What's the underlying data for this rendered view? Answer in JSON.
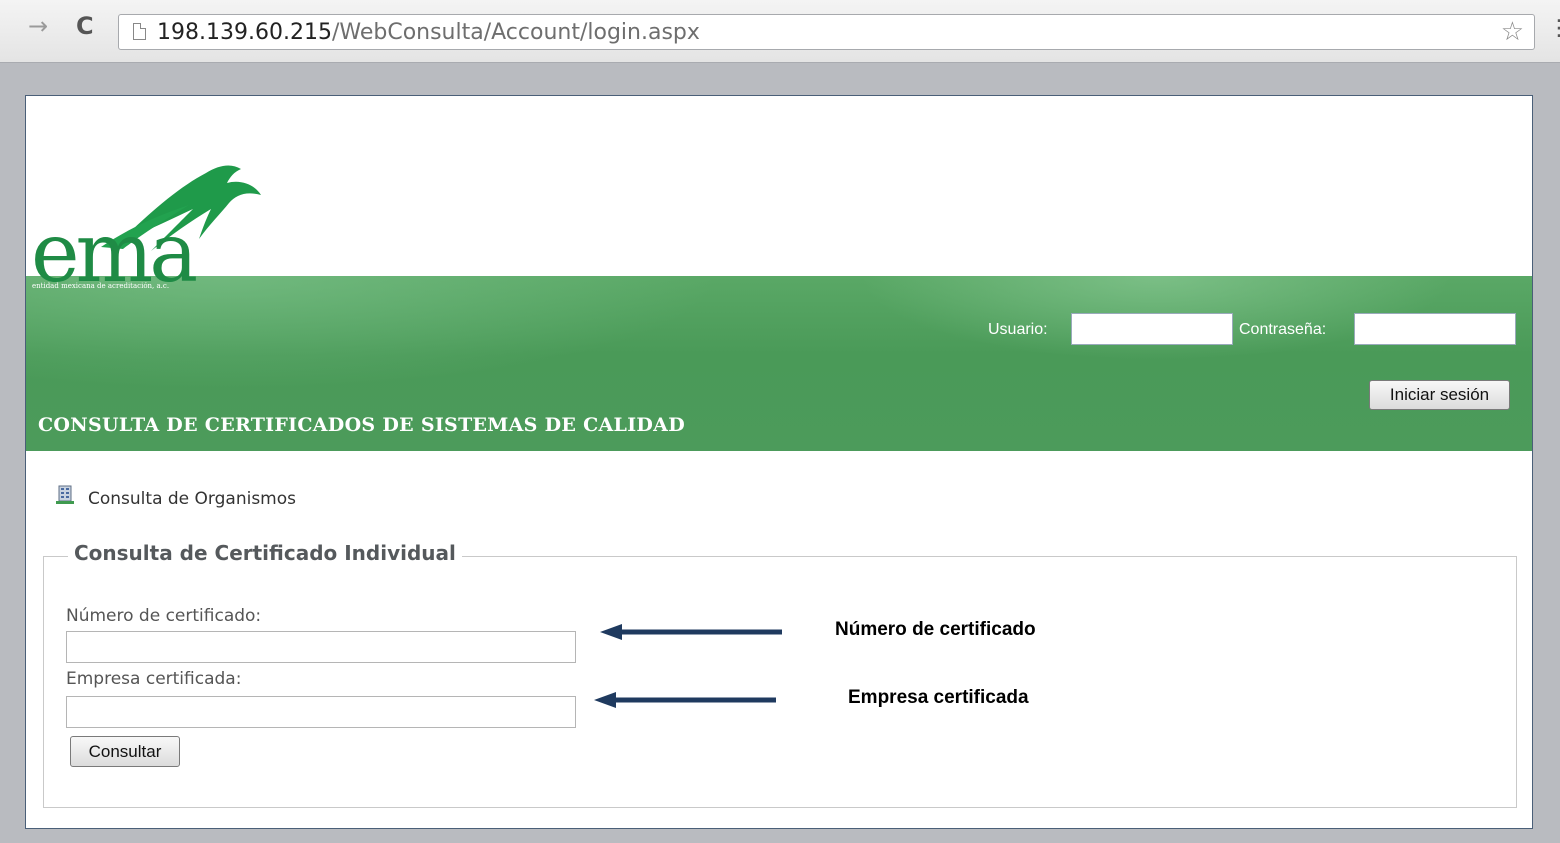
{
  "browser": {
    "url_host": "198.139.60.215",
    "url_path": "/WebConsulta/Account/login.aspx",
    "icons": [
      "forward-icon",
      "reload-icon",
      "page-icon",
      "star-icon",
      "menu-icon"
    ]
  },
  "header": {
    "logo_text": "ema",
    "logo_subtitle": "entidad mexicana de acreditación, a.c.",
    "user_label": "Usuario:",
    "user_value": "",
    "password_label": "Contraseña:",
    "password_value": "",
    "login_button": "Iniciar sesión",
    "app_title": "CONSULTA DE CERTIFICADOS DE SISTEMAS DE CALIDAD",
    "colors": {
      "banner": "#4c9b5b",
      "logo_green": "#1f8b45"
    }
  },
  "main": {
    "org_link_label": "Consulta de Organismos",
    "fieldset": {
      "legend": "Consulta de Certificado Individual",
      "cert_number_label": "Número de certificado:",
      "cert_number_value": "",
      "company_label": "Empresa certificada:",
      "company_value": "",
      "submit_label": "Consultar"
    }
  },
  "annotations": {
    "note_cert_number": "Número de certificado",
    "note_company": "Empresa certificada",
    "arrow_color": "#1f3a5f"
  }
}
